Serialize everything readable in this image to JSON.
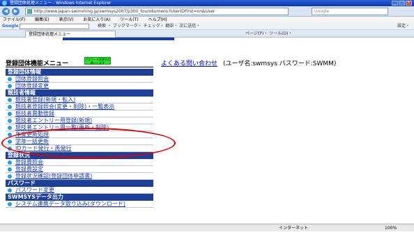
{
  "window": {
    "title": "登録団体処理メニュー - Windows Internet Explorer"
  },
  "address": {
    "url": "http://www.japan-swimming.jp/swmsys2007/p300_tourokumenu?UserIDFirst=on&User",
    "search_placeholder": "Google"
  },
  "menubar": [
    "ファイル(F)",
    "編集(E)",
    "表示(V)",
    "お気に入り(A)",
    "ツール(T)",
    "ヘルプ(H)"
  ],
  "googlebar": {
    "logo": "Google",
    "items": "検索 ・ ブックマーク・ チェック・ 翻訳・ 次に送信・",
    "settings": "設定・"
  },
  "tab": {
    "label": "登録団体処理メニュー",
    "tools": "ページ(P)・ ツール(O)・"
  },
  "page": {
    "title": "登録団体機能メニュー",
    "notice": "パスワード変更をお願いします",
    "faq_link": "よくある問い合わせ",
    "user_info": "(ユーザ名:swmsys パスワード:SWMM)"
  },
  "menu": [
    {
      "section": "登録団体情報",
      "items": [
        "団体登録照会",
        "団体登録変更"
      ]
    },
    {
      "section": "競技者情報",
      "items": [
        "競技者登録(新規・転入)",
        "競技者登録照会(変更・削除)・一覧表示",
        "競技者異動登録",
        "競技者エントリー用登録(新規)",
        "競技者エントリー用一覧(更新・削除)",
        "年度更新処理",
        "学年一括更新",
        "IDカード発行・再発行"
      ]
    },
    {
      "section": "登録状況",
      "items": [
        "登録費照会",
        "登録費設定",
        "登録状況確認(登録団体申請書)"
      ]
    },
    {
      "section": "パスワード",
      "items": [
        "パスワード変更"
      ]
    },
    {
      "section": "SWMSYSデータ出力",
      "items": [
        "システム連携データ取り込み(ダウンロード)"
      ]
    }
  ],
  "status": {
    "zone": "インターネット",
    "zoom": "100%"
  }
}
